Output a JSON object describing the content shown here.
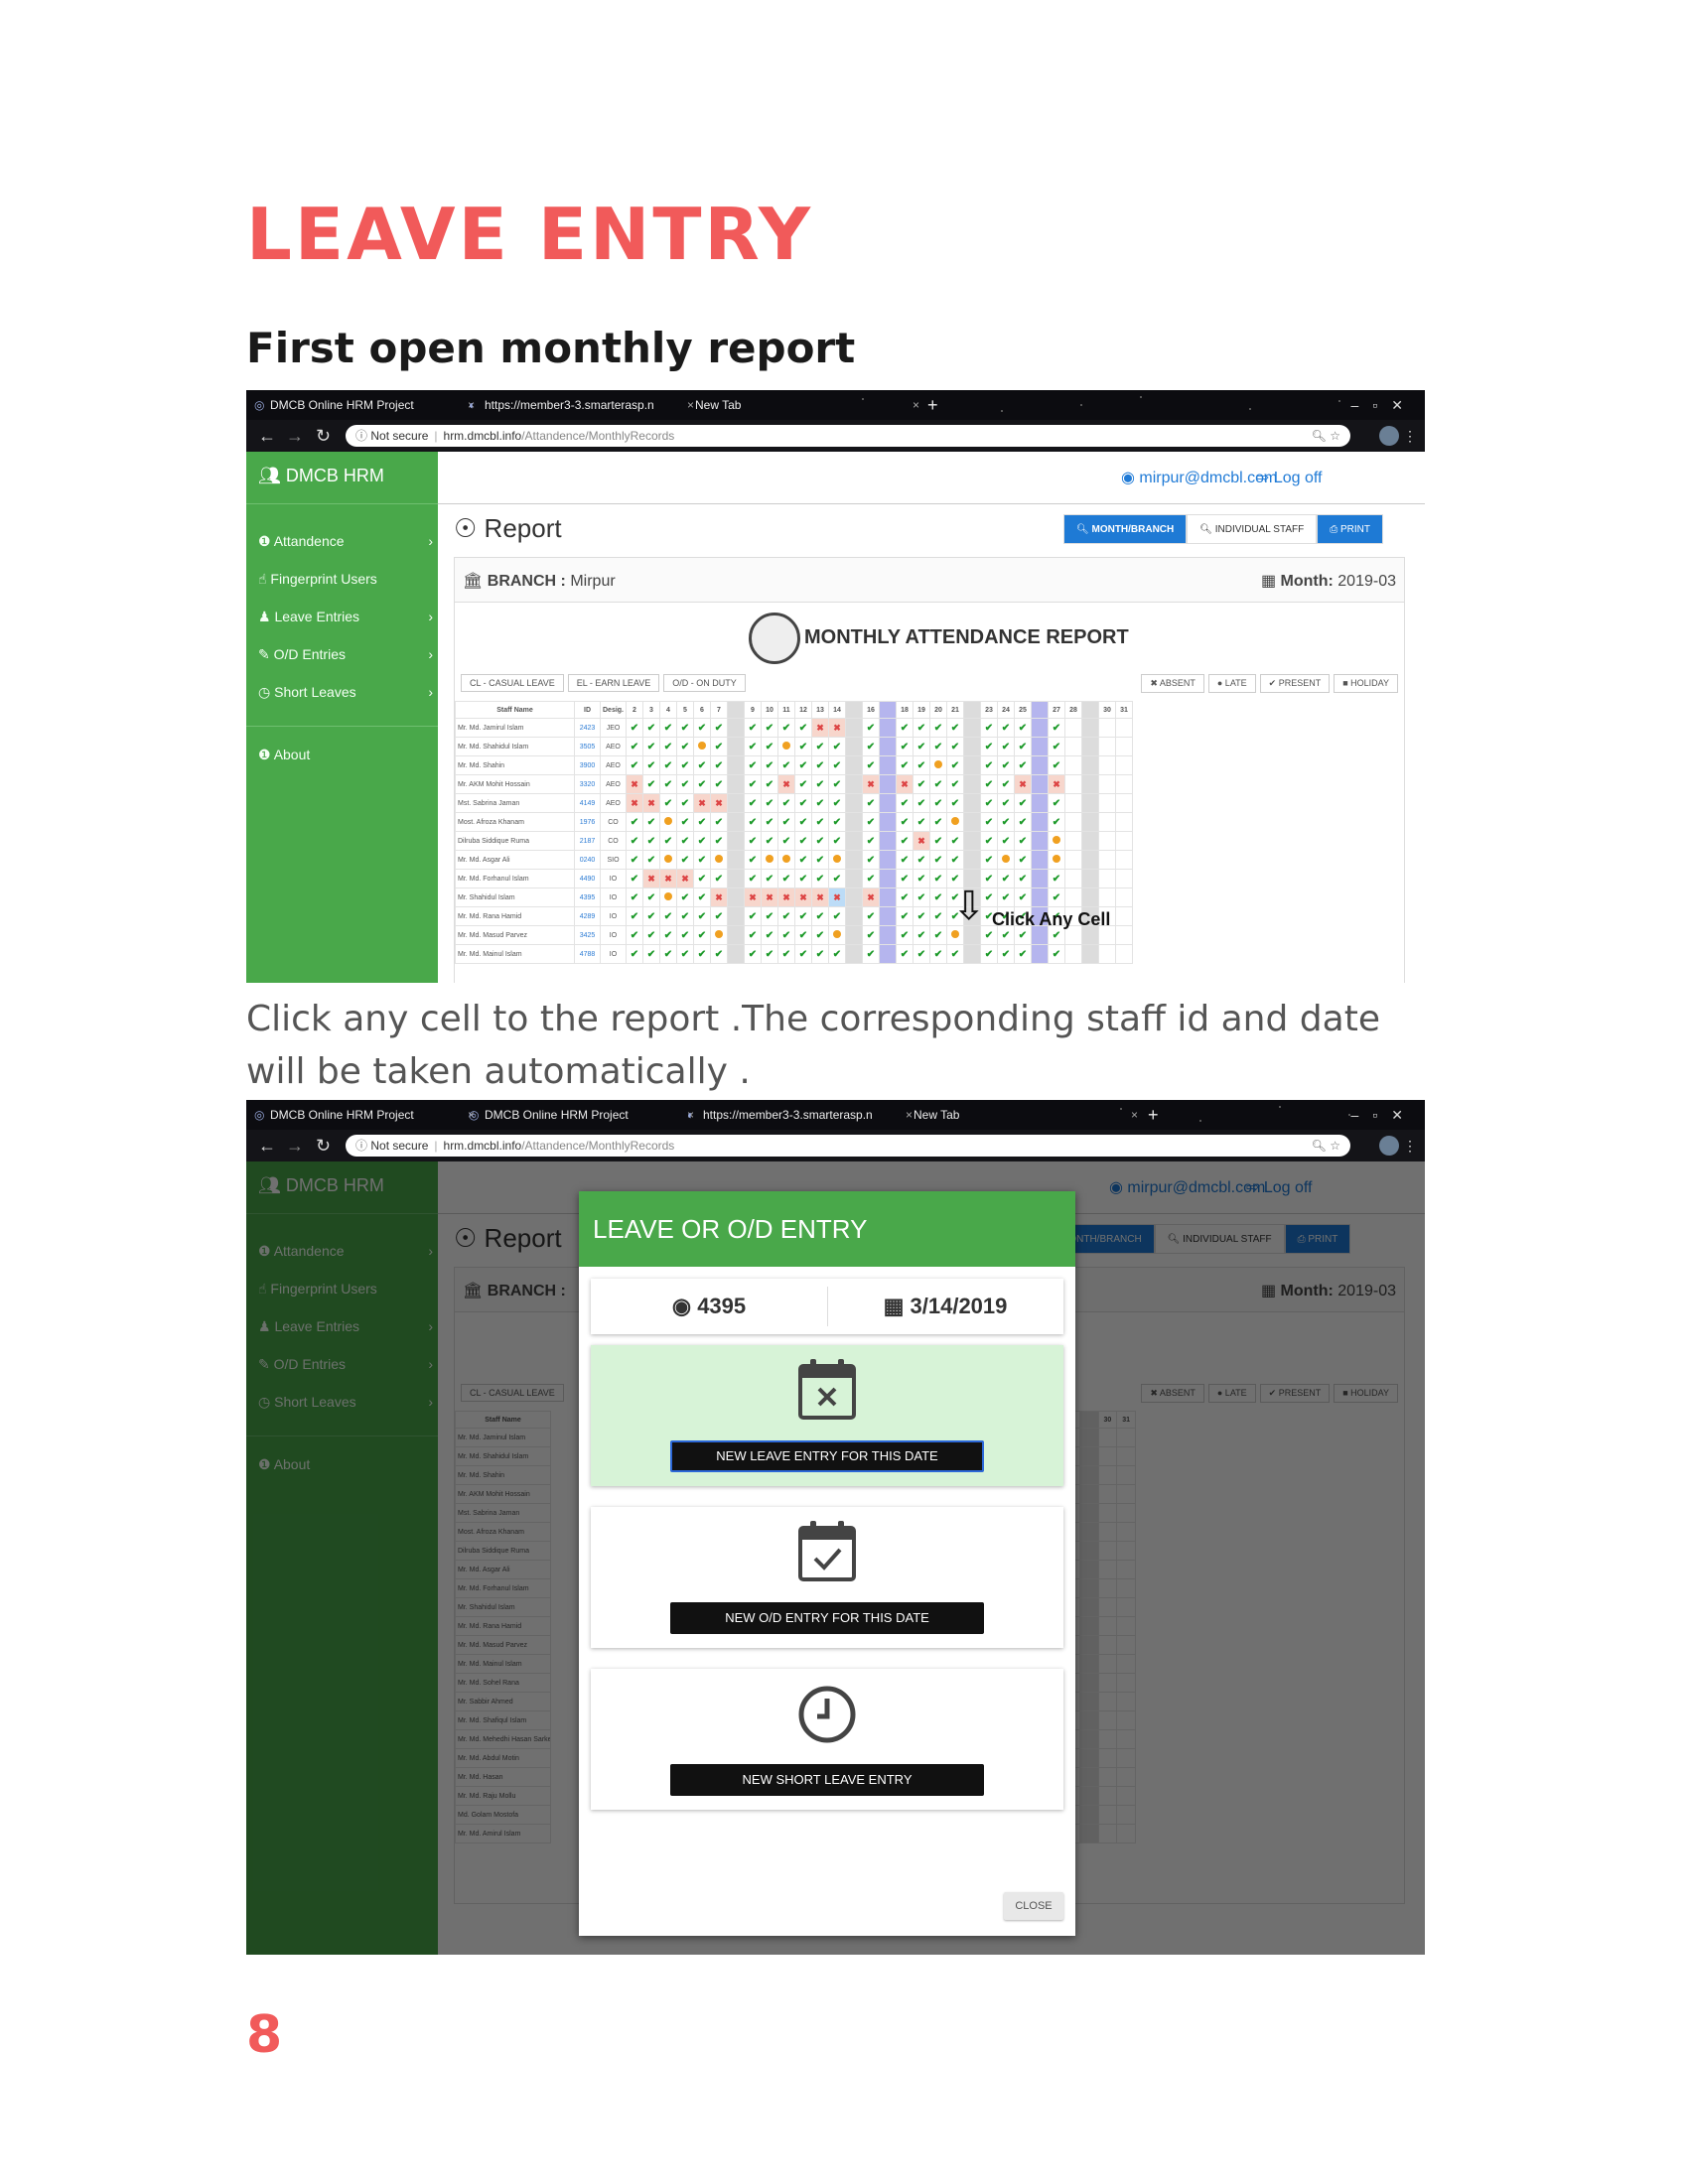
{
  "doc": {
    "title": "LEAVE ENTRY",
    "subtitle": "First open monthly report",
    "paragraph": "Click any cell to the report .The corresponding staff id and date will be taken automatically .",
    "page_number": "8"
  },
  "browser1": {
    "tabs": [
      "DMCB Online HRM Project",
      "https://member3-3.smarterasp.n",
      "New Tab"
    ],
    "not_secure": "Not secure",
    "url_host": "hrm.dmcbl.info",
    "url_path": "/Attandence/MonthlyRecords"
  },
  "browser2": {
    "tabs": [
      "DMCB Online HRM Project",
      "DMCB Online HRM Project",
      "https://member3-3.smarterasp.n",
      "New Tab"
    ],
    "not_secure": "Not secure",
    "url_host": "hrm.dmcbl.info",
    "url_path": "/Attandence/MonthlyRecords"
  },
  "app": {
    "brand": "DMCB HRM",
    "nav": [
      "Attandence",
      "Fingerprint Users",
      "Leave Entries",
      "O/D Entries",
      "Short Leaves",
      "About"
    ],
    "user": "mirpur@dmcbl.com",
    "logoff": "Log off",
    "page_title": "Report",
    "btn_month": "MONTH/BRANCH",
    "btn_individual": "INDIVIDUAL STAFF",
    "btn_print": "PRINT",
    "branch_label": "BRANCH :",
    "branch_value": "Mirpur",
    "month_label": "Month:",
    "month_value": "2019-03",
    "report_title": "MONTHLY ATTENDANCE REPORT",
    "legend_left": [
      "CL - CASUAL LEAVE",
      "EL - EARN LEAVE",
      "O/D - ON DUTY"
    ],
    "legend_right": [
      "✖ ABSENT",
      "● LATE",
      "✔ PRESENT",
      "■ HOLIDAY"
    ],
    "col_name": "Staff Name",
    "col_id": "ID",
    "col_desig": "Desig.",
    "annotation": "Click Any Cell"
  },
  "table1": {
    "days": [
      "2",
      "3",
      "4",
      "5",
      "6",
      "7",
      "",
      "9",
      "10",
      "11",
      "12",
      "13",
      "14",
      "",
      "16",
      "",
      "18",
      "19",
      "20",
      "21",
      "",
      "23",
      "24",
      "25",
      "",
      "27",
      "28",
      "",
      "30",
      "31"
    ],
    "rows": [
      {
        "name": "Mr. Md. Jamirul Islam",
        "id": "2423",
        "desig": "JEO",
        "marks": "kkkkkk.kkkkxx.k.kkkk.kkk.k...."
      },
      {
        "name": "Mr. Md. Shahidul Islam",
        "id": "3505",
        "desig": "AEO",
        "marks": "kkkkok.kkokkk.k.kkkk.kkk.k...."
      },
      {
        "name": "Mr. Md. Shahin",
        "id": "3900",
        "desig": "AEO",
        "marks": "kkkkkk.kkkkkk.k.kkok.kkk.k...."
      },
      {
        "name": "Mr. AKM Mohit Hossain",
        "id": "3320",
        "desig": "AEO",
        "marks": "xkkkkk.kkxkkk.x.xkkk.kkx.x...."
      },
      {
        "name": "Mst. Sabrina Jaman",
        "id": "4149",
        "desig": "AEO",
        "marks": "xxkkxx.kkkkkk.k.kkkk.kkk.k...."
      },
      {
        "name": "Most. Afroza Khanam",
        "id": "1976",
        "desig": "CO",
        "marks": "kkokkk.kkkkkk.k.kkko.kkk.k...."
      },
      {
        "name": "Dilruba Siddique Ruma",
        "id": "2187",
        "desig": "CO",
        "marks": "kkkkkk.kkkkkk.k.kxkk.kkk.o...."
      },
      {
        "name": "Mr. Md. Asgar Ali",
        "id": "0240",
        "desig": "SIO",
        "marks": "kkokko.kookko.k.kkkk.kok.o...."
      },
      {
        "name": "Mr. Md. Forhanul Islam",
        "id": "4490",
        "desig": "IO",
        "marks": "kxxxkk.kkkkkk.k.kkkk.kkk.k...."
      },
      {
        "name": "Mr. Shahidul Islam",
        "id": "4395",
        "desig": "IO",
        "marks": "kkokkx.xxxxxs.x.kkkk.kkk.k...."
      },
      {
        "name": "Mr. Md. Rana Hamid",
        "id": "4289",
        "desig": "IO",
        "marks": "kkkkkk.kkkkkk.k.kkkk.kkk.k...."
      },
      {
        "name": "Mr. Md. Masud Parvez",
        "id": "3425",
        "desig": "IO",
        "marks": "kkkkko.kkkkko.k.kkko.kkk.k...."
      },
      {
        "name": "Mr. Md. Mainul Islam",
        "id": "4788",
        "desig": "IO",
        "marks": "kkkkkk.kkkkkk.k.kkkk.kkk.k...."
      }
    ]
  },
  "table2": {
    "names": [
      "Mr. Md. Jaminul Islam",
      "Mr. Md. Shahidul Islam",
      "Mr. Md. Shahin",
      "Mr. AKM Mohit Hossain",
      "Mst. Sabrina Jaman",
      "Most. Afroza Khanam",
      "Dilruba Siddique Ruma",
      "Mr. Md. Asgar Ali",
      "Mr. Md. Forhanul Islam",
      "Mr. Shahidul Islam",
      "Mr. Md. Rana Hamid",
      "Mr. Md. Masud Parvez",
      "Mr. Md. Mainul Islam",
      "Mr. Md. Sohel Rana",
      "Mr. Sabbir Ahmed",
      "Mr. Md. Shafiqul Islam",
      "Mr. Md. Mehedhi Hasan Sarker",
      "Mr. Md. Abdul Motin",
      "Mr. Md. Hasan",
      "Mr. Md. Raju Mollu",
      "Md. Golam Mostofa",
      "Mr. Md. Amirul Islam"
    ],
    "days": [
      "19",
      "20",
      "21",
      "",
      "23",
      "24",
      "25",
      "",
      "27",
      "28",
      "",
      "30",
      "31"
    ],
    "marks": [
      "kkk.kkk.k....",
      "kkk.kkk.k....",
      "kok.kkk.k....",
      "kkk.kkx.x....",
      "kkk.kkk.k....",
      "kko.kkk.k....",
      "xkk.kkk.o....",
      "koo.kok.o....",
      "kkk.kkk.k....",
      "kkk.kkk.k....",
      "kkk.kkk.k....",
      "kko.kkk.k....",
      "kkk.kkk.k....",
      "kkk.oko.k....",
      "kkk.kkk.k....",
      "kkk.kkk.k....",
      "kok.kkk.k....",
      "kkk.kkk.k....",
      "kkk.kkk.k....",
      "kkk.kkk.k....",
      "kkk.kkk.k....",
      "kkk.kkk.k...."
    ]
  },
  "modal": {
    "title": "LEAVE OR O/D ENTRY",
    "staff_id": "4395",
    "date": "3/14/2019",
    "btn_leave": "NEW LEAVE ENTRY FOR THIS DATE",
    "btn_od": "NEW O/D ENTRY FOR THIS DATE",
    "btn_short": "NEW SHORT LEAVE ENTRY",
    "close": "CLOSE"
  },
  "colors": {
    "accent_red": "#f15a5a",
    "green": "#49a84a",
    "blue": "#1e7ad5"
  }
}
